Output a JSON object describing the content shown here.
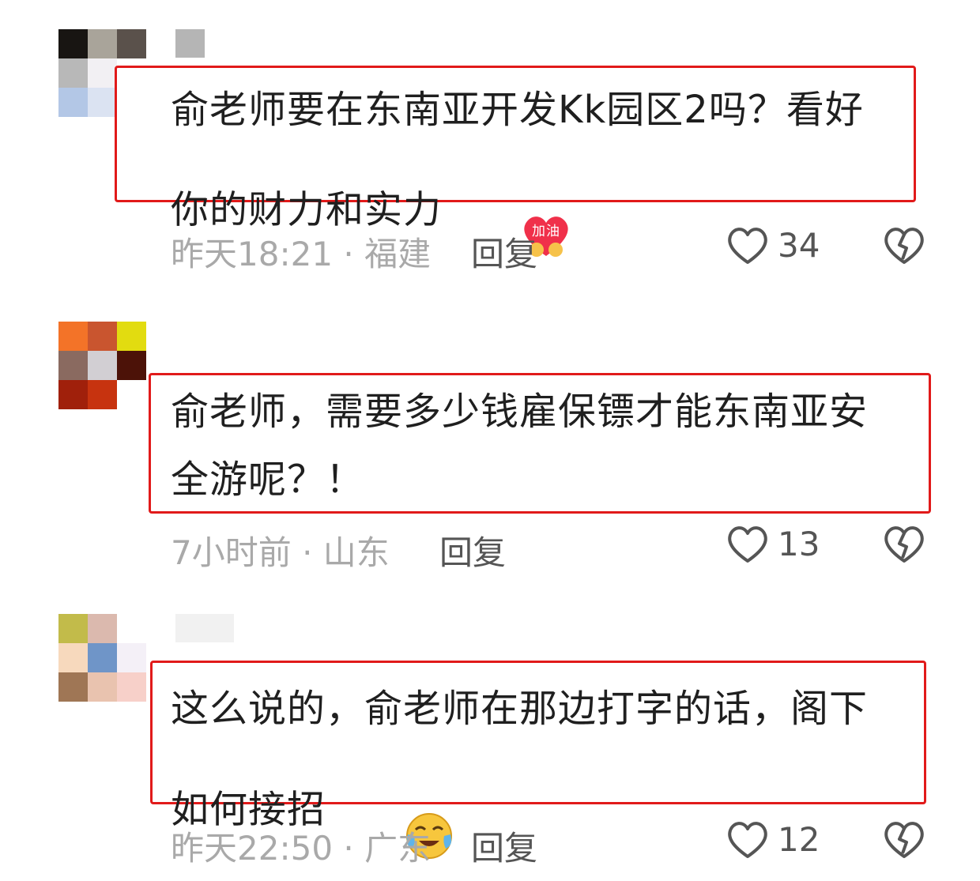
{
  "comments": [
    {
      "text": "俞老师要在东南亚开发Kk园区2吗？看好\n你的财力和实力",
      "emoji_label": "加油",
      "emoji_icon": "jiayou-heart-emoji",
      "time_location": "昨天18:21 · 福建",
      "reply_label": "回复",
      "likes": "34"
    },
    {
      "text": "俞老师，需要多少钱雇保镖才能东南亚安\n全游呢？！",
      "time_location": "7小时前 · 山东",
      "reply_label": "回复",
      "likes": "13"
    },
    {
      "text": "这么说的，俞老师在那边打字的话，阁下\n如何接招",
      "emoji_icon": "crying-laughing-emoji",
      "time_location": "昨天22:50 · 广东",
      "reply_label": "回复",
      "likes": "12"
    }
  ],
  "colors": {
    "highlight_box": "#e11a1a",
    "meta_text": "#a9a9a9",
    "accent_emoji": "#f0304a"
  }
}
